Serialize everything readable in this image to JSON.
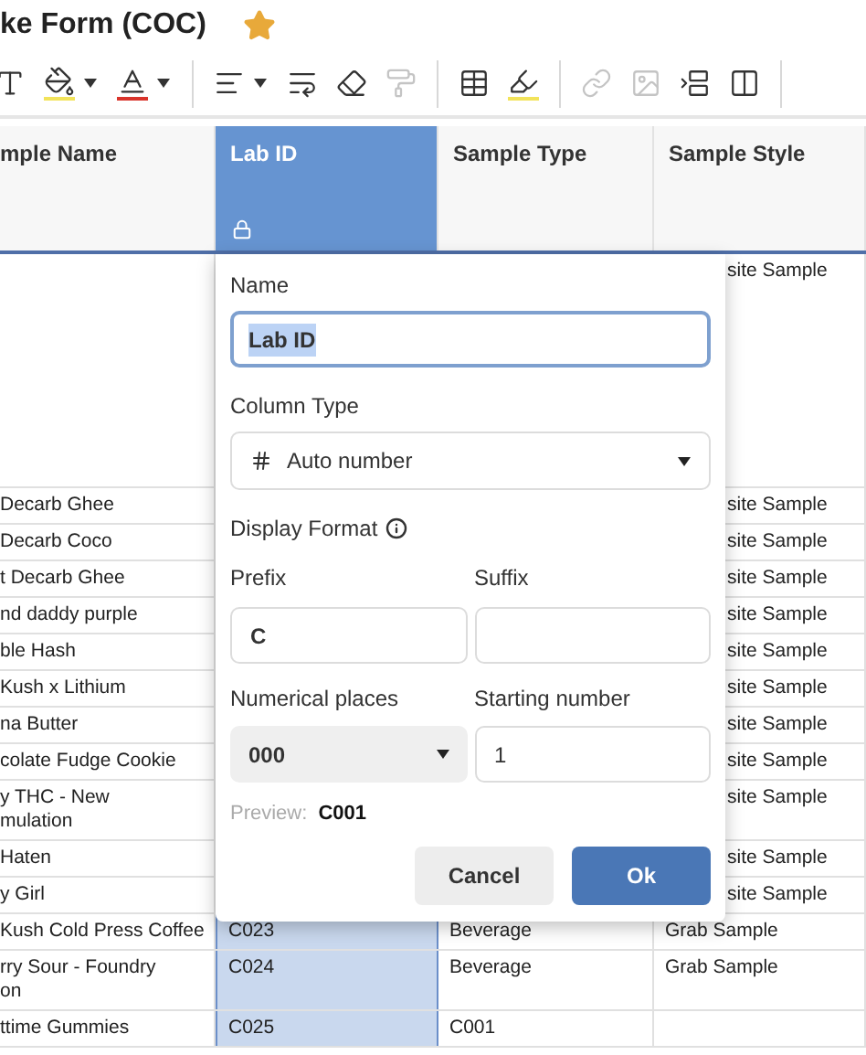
{
  "title": "ke Form (COC)",
  "starred": true,
  "toolbar": [
    {
      "kind": "text-style",
      "disabled": false
    },
    {
      "kind": "fill-color",
      "disabled": false
    },
    {
      "kind": "caret",
      "disabled": false
    },
    {
      "kind": "text-color",
      "disabled": false
    },
    {
      "kind": "caret",
      "disabled": false
    },
    {
      "kind": "separator"
    },
    {
      "kind": "align",
      "disabled": false
    },
    {
      "kind": "caret",
      "disabled": false
    },
    {
      "kind": "wrap",
      "disabled": false
    },
    {
      "kind": "eraser",
      "disabled": false
    },
    {
      "kind": "format-painter",
      "disabled": true
    },
    {
      "kind": "separator"
    },
    {
      "kind": "table",
      "disabled": false
    },
    {
      "kind": "highlighter",
      "disabled": false
    },
    {
      "kind": "separator"
    },
    {
      "kind": "link",
      "disabled": true
    },
    {
      "kind": "image",
      "disabled": true
    },
    {
      "kind": "insert-row",
      "disabled": false
    },
    {
      "kind": "insert-column",
      "disabled": false
    },
    {
      "kind": "separator"
    }
  ],
  "columns": [
    {
      "label": "mple Name",
      "selected": false,
      "locked": false
    },
    {
      "label": "Lab ID",
      "selected": true,
      "locked": true
    },
    {
      "label": "Sample Type",
      "selected": false,
      "locked": false
    },
    {
      "label": "Sample Style",
      "selected": false,
      "locked": false
    }
  ],
  "rows": [
    {
      "sample_style": "site Sample"
    },
    {
      "sample_name": "Decarb Ghee",
      "sample_style": "site Sample"
    },
    {
      "sample_name": "Decarb Coco",
      "sample_style": "site Sample"
    },
    {
      "sample_name": "t Decarb Ghee",
      "sample_style": "site Sample"
    },
    {
      "sample_name": "nd daddy purple",
      "sample_style": "site Sample"
    },
    {
      "sample_name": "ble Hash",
      "sample_style": "site Sample"
    },
    {
      "sample_name": "Kush x Lithium",
      "sample_style": "site Sample"
    },
    {
      "sample_name": "na Butter",
      "sample_style": "site Sample"
    },
    {
      "sample_name": "colate Fudge Cookie",
      "sample_style": "site Sample"
    },
    {
      "sample_name": "y THC - New\nmulation",
      "sample_style": "site Sample"
    },
    {
      "sample_name": "Haten",
      "sample_style": "site Sample"
    },
    {
      "sample_name": "y Girl",
      "sample_style": "site Sample"
    },
    {
      "sample_name": "Kush Cold Press Coffee",
      "lab_id": "C023",
      "sample_type": "Beverage",
      "sample_style": "Grab Sample"
    },
    {
      "sample_name": "rry Sour - Foundry\non",
      "lab_id": "C024",
      "sample_type": "Beverage",
      "sample_style": "Grab Sample"
    },
    {
      "sample_name": "ttime Gummies",
      "lab_id": "C025",
      "sample_type": "C001"
    }
  ],
  "dialog": {
    "name": {
      "label": "Name",
      "value": "Lab ID"
    },
    "column_type": {
      "label": "Column Type",
      "value": "Auto number"
    },
    "display_format": {
      "label": "Display Format"
    },
    "prefix": {
      "label": "Prefix",
      "value": "C"
    },
    "suffix": {
      "label": "Suffix"
    },
    "numerical_places": {
      "label": "Numerical places",
      "value": "000"
    },
    "starting_number": {
      "label": "Starting number",
      "value": "1"
    },
    "preview": {
      "label": "Preview:",
      "value": "C001"
    },
    "buttons": [
      "Cancel",
      "Ok"
    ]
  }
}
